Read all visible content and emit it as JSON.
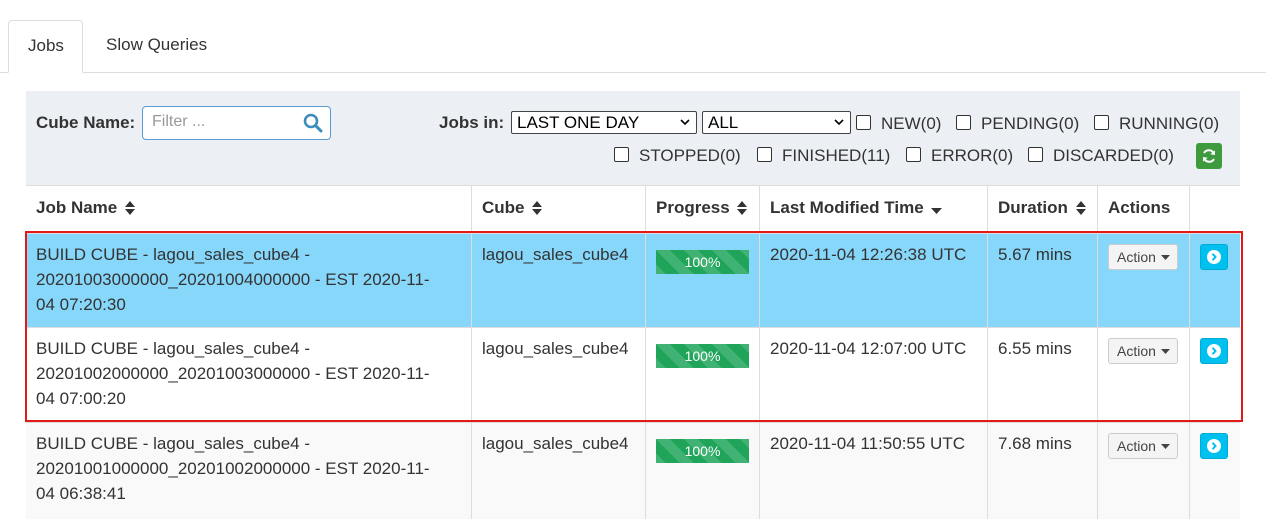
{
  "tabs": [
    {
      "label": "Jobs",
      "active": true
    },
    {
      "label": "Slow Queries",
      "active": false
    }
  ],
  "filters": {
    "cube_name_label": "Cube Name:",
    "cube_name_placeholder": "Filter ...",
    "jobs_in_label": "Jobs in:",
    "time_select_value": "LAST ONE DAY",
    "project_select_value": "ALL",
    "status_checkboxes": [
      {
        "label": "NEW(0)",
        "checked": false
      },
      {
        "label": "PENDING(0)",
        "checked": false
      },
      {
        "label": "RUNNING(0)",
        "checked": false
      },
      {
        "label": "STOPPED(0)",
        "checked": false
      },
      {
        "label": "FINISHED(11)",
        "checked": false
      },
      {
        "label": "ERROR(0)",
        "checked": false
      },
      {
        "label": "DISCARDED(0)",
        "checked": false
      }
    ],
    "refresh_icon": "refresh-icon",
    "search_icon": "search-icon"
  },
  "table": {
    "columns": [
      "Job Name",
      "Cube",
      "Progress",
      "Last Modified Time",
      "Duration",
      "Actions"
    ],
    "rows": [
      {
        "job_name_lines": [
          "BUILD CUBE - lagou_sales_cube4 -",
          "20201003000000_20201004000000 - EST 2020-11-",
          "04 07:20:30"
        ],
        "cube": "lagou_sales_cube4",
        "progress": "100%",
        "last_modified": "2020-11-04 12:26:38 UTC",
        "duration": "5.67 mins",
        "action_label": "Action"
      },
      {
        "job_name_lines": [
          "BUILD CUBE - lagou_sales_cube4 -",
          "20201002000000_20201003000000 - EST 2020-11-",
          "04 07:00:20"
        ],
        "cube": "lagou_sales_cube4",
        "progress": "100%",
        "last_modified": "2020-11-04 12:07:00 UTC",
        "duration": "6.55 mins",
        "action_label": "Action"
      },
      {
        "job_name_lines": [
          "BUILD CUBE - lagou_sales_cube4 -",
          "20201001000000_20201002000000 - EST 2020-11-",
          "04 06:38:41"
        ],
        "cube": "lagou_sales_cube4",
        "progress": "100%",
        "last_modified": "2020-11-04 11:50:55 UTC",
        "duration": "7.68 mins",
        "action_label": "Action"
      }
    ]
  },
  "colors": {
    "selected_row": "#87d7fb",
    "progress_bar": "#1fa45a",
    "highlight_border": "#e31818",
    "go_button": "#00c0ef",
    "refresh_button": "#3d9b3d"
  }
}
